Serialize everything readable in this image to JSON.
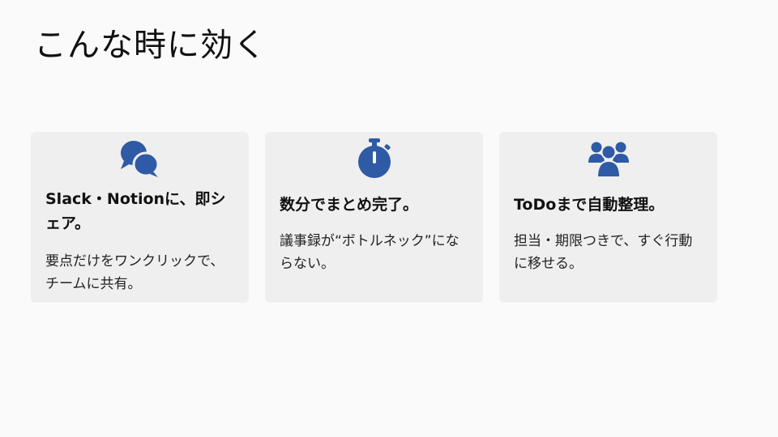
{
  "slide": {
    "title": "こんな時に効く"
  },
  "cards": [
    {
      "icon": "chat-bubbles-icon",
      "heading": "Slack・Notionに、即シェア。",
      "body": "要点だけをワンクリックで、チームに共有。"
    },
    {
      "icon": "stopwatch-icon",
      "heading": "数分でまとめ完了。",
      "body": "議事録が“ボトルネック”にならない。"
    },
    {
      "icon": "users-group-icon",
      "heading": "ToDoまで自動整理。",
      "body": "担当・期限つきで、すぐ行動に移せる。"
    }
  ],
  "colors": {
    "accent": "#2e5aa6",
    "background": "#fafafb",
    "card": "#efeff0"
  }
}
